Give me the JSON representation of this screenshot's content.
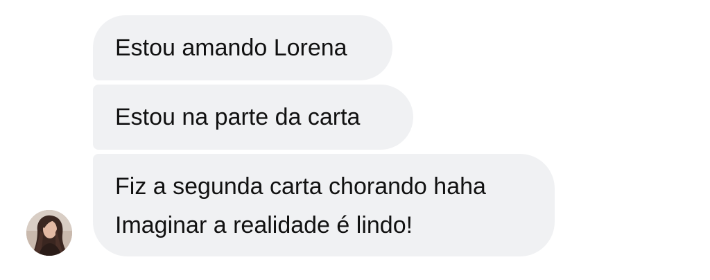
{
  "conversation": {
    "messages": [
      {
        "lines": [
          "Estou amando Lorena"
        ]
      },
      {
        "lines": [
          "Estou na parte da carta"
        ]
      },
      {
        "lines": [
          "Fiz a segunda carta chorando haha",
          "Imaginar a realidade é lindo!"
        ]
      }
    ],
    "sender_avatar": {
      "icon": "user-avatar-photo",
      "colors": {
        "hair": "#3a2620",
        "skin": "#e2b9a3",
        "background": "#c9b9ad"
      }
    },
    "bubble_color": "#f0f1f3",
    "text_color": "#111111"
  }
}
